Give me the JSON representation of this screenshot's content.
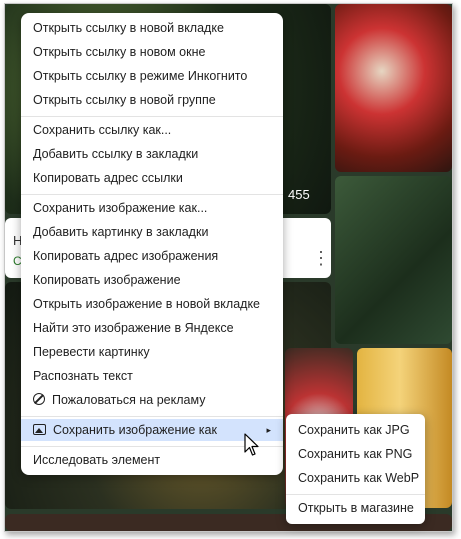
{
  "background": {
    "photo_count_badge": "455",
    "card_letter": "Н",
    "card_letter_green": "С",
    "card_menu_icon": "kebab-icon"
  },
  "context_menu": {
    "groups": [
      [
        "Открыть ссылку в новой вкладке",
        "Открыть ссылку в новом окне",
        "Открыть ссылку в режиме Инкогнито",
        "Открыть ссылку в новой группе"
      ],
      [
        "Сохранить ссылку как...",
        "Добавить ссылку в закладки",
        "Копировать адрес ссылки"
      ],
      [
        "Сохранить изображение как...",
        "Добавить картинку в закладки",
        "Копировать адрес изображения",
        "Копировать изображение",
        "Открыть изображение в новой вкладке",
        "Найти это изображение в Яндексе",
        "Перевести картинку",
        "Распознать текст",
        "Пожаловаться на рекламу"
      ],
      [
        "Сохранить изображение как"
      ],
      [
        "Исследовать элемент"
      ]
    ],
    "report_icon": "ban-icon",
    "save_as_icon": "image-icon",
    "submenu_arrow": "▸"
  },
  "submenu": {
    "items": [
      "Сохранить как JPG",
      "Сохранить как PNG",
      "Сохранить как WebP"
    ],
    "footer": "Открыть в магазине"
  },
  "colors": {
    "highlight": "#d3e3fd"
  }
}
